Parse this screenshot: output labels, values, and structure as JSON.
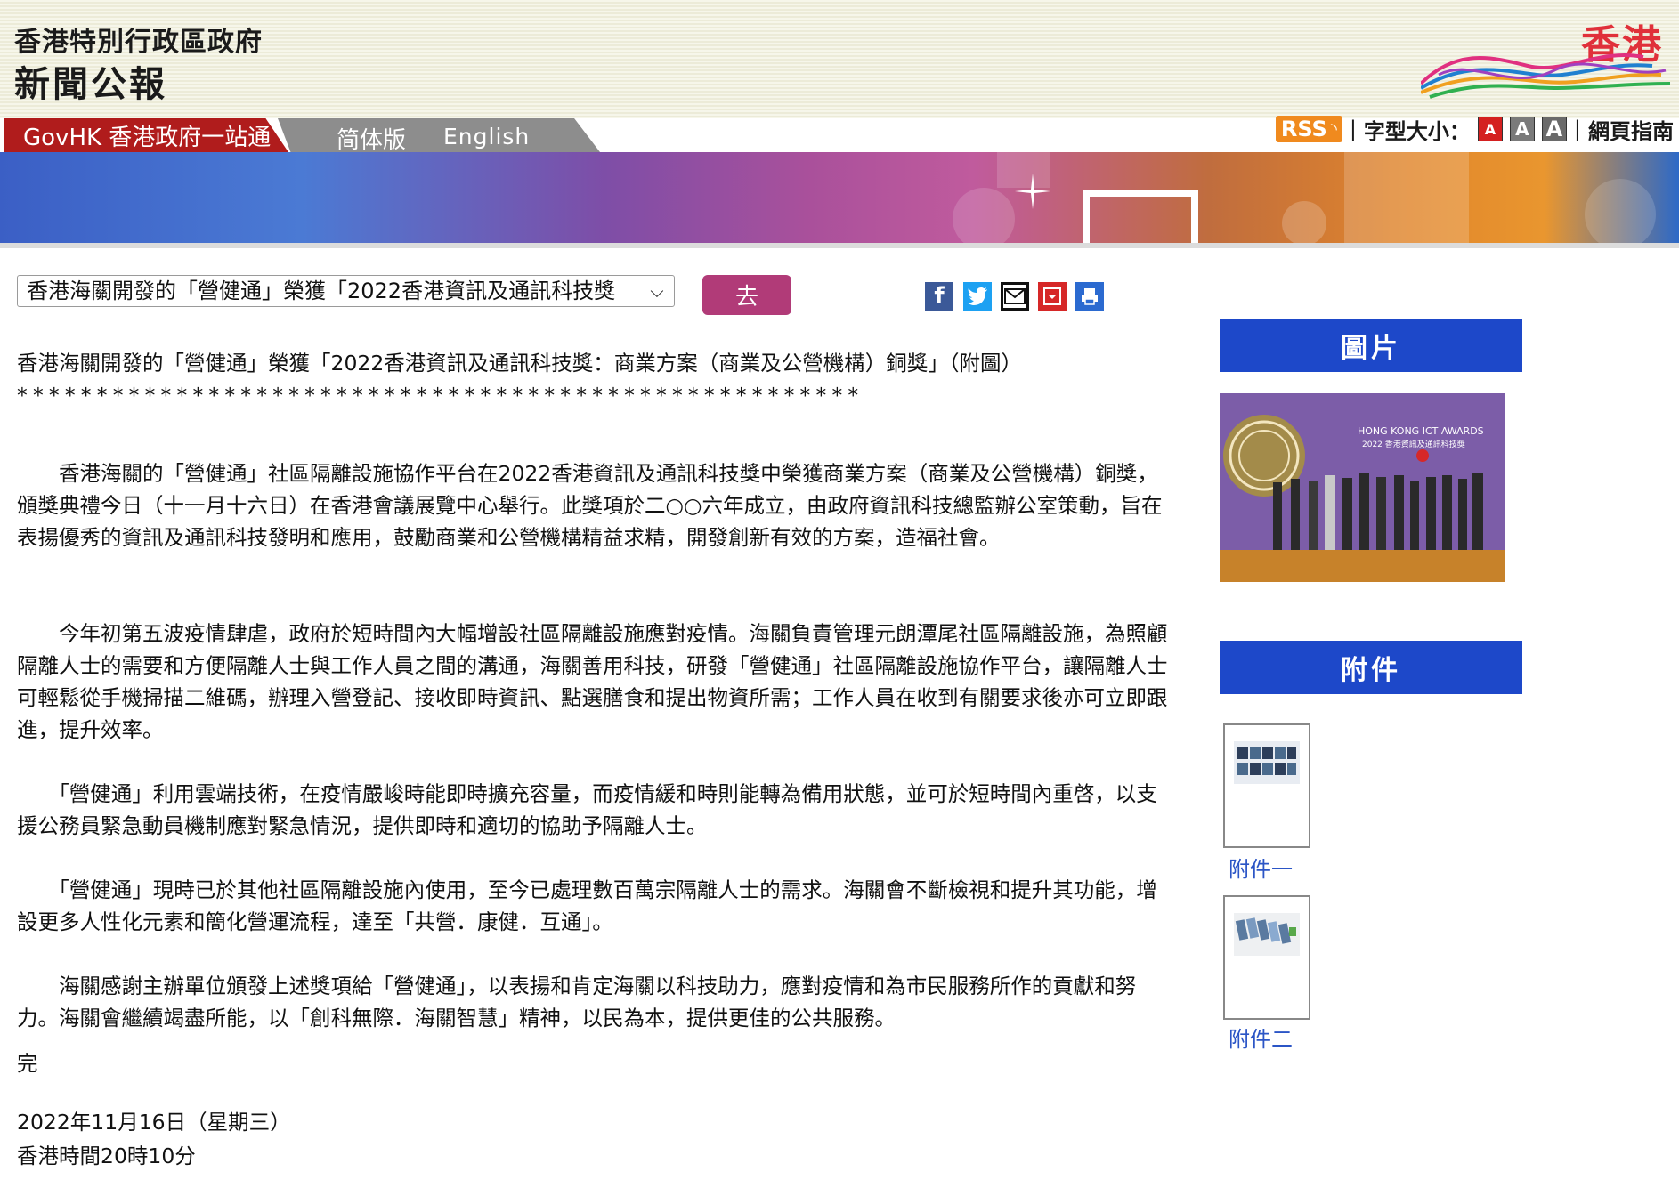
{
  "header": {
    "line1": "香港特別行政區政府",
    "line2": "新聞公報",
    "logo_text": "香港"
  },
  "nav": {
    "govhk": "GovHK 香港政府一站通",
    "simplified": "简体版",
    "english": "English"
  },
  "tools": {
    "rss": "RSS",
    "sep1": "|",
    "font_size_label": "字型大小：",
    "font_small": "A",
    "font_medium": "A",
    "font_large": "A",
    "sep2": "|",
    "sitemap": "網頁指南"
  },
  "selector": {
    "selected": "香港海關開發的「營健通」榮獲「2022香港資訊及通訊科技獎",
    "go": "去"
  },
  "share_icons": [
    "facebook-icon",
    "twitter-icon",
    "email-icon",
    "download-icon",
    "print-icon"
  ],
  "article": {
    "title": "香港海關開發的「營健通」榮獲「2022香港資訊及通訊科技獎：商業方案（商業及公營機構）銅獎」（附圖）",
    "stars": "*****************************************************",
    "paragraphs": [
      "　　香港海關的「營健通」社區隔離設施協作平台在2022香港資訊及通訊科技獎中榮獲商業方案（商業及公營機構）銅獎，頒獎典禮今日（十一月十六日）在香港會議展覽中心舉行。此獎項於二○○六年成立，由政府資訊科技總監辦公室策動，旨在表揚優秀的資訊及通訊科技發明和應用，鼓勵商業和公營機構精益求精，開發創新有效的方案，造福社會。",
      "　　今年初第五波疫情肆虐，政府於短時間內大幅增設社區隔離設施應對疫情。海關負責管理元朗潭尾社區隔離設施，為照顧隔離人士的需要和方便隔離人士與工作人員之間的溝通，海關善用科技，研發「營健通」社區隔離設施協作平台，讓隔離人士可輕鬆從手機掃描二維碼，辦理入營登記、接收即時資訊、點選膳食和提出物資所需；工作人員在收到有關要求後亦可立即跟進，提升效率。",
      "　　「營健通」利用雲端技術，在疫情嚴峻時能即時擴充容量，而疫情緩和時則能轉為備用狀態，並可於短時間內重啓，以支援公務員緊急動員機制應對緊急情況，提供即時和適切的協助予隔離人士。",
      "　　「營健通」現時已於其他社區隔離設施內使用，至今已處理數百萬宗隔離人士的需求。海關會不斷檢視和提升其功能，增設更多人性化元素和簡化營運流程，達至「共營．康健．互通」。",
      "　　海關感謝主辦單位頒發上述獎項給「營健通」，以表揚和肯定海關以科技助力，應對疫情和為市民服務所作的貢獻和努力。海關會繼續竭盡所能，以「創科無際．海關智慧」精神，以民為本，提供更佳的公共服務。"
    ],
    "end": "完",
    "date": "2022年11月16日（星期三）",
    "time": "香港時間20時10分"
  },
  "sidebar": {
    "photos_heading": "圖片",
    "photo_caption_line1": "HONG KONG ICT AWARDS",
    "photo_caption_line2": "2022 香港資訊及通訊科技獎",
    "attachments_heading": "附件",
    "attachments": [
      {
        "label": "附件一"
      },
      {
        "label": "附件二"
      }
    ]
  },
  "colors": {
    "sidebar_heading_bg": "#1d48c9",
    "go_button_bg": "#b13b78",
    "govhk_tab_bg": "#b01c1c",
    "link": "#2b55c6"
  }
}
